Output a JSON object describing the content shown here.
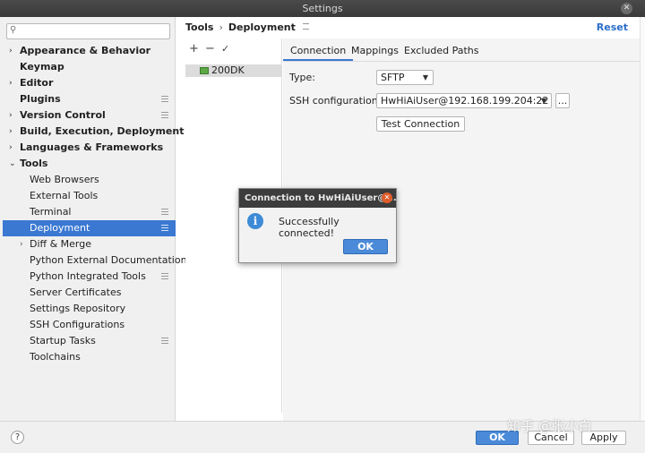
{
  "window": {
    "title": "Settings"
  },
  "search": {
    "placeholder": ""
  },
  "tree": [
    {
      "label": "Appearance & Behavior",
      "bold": true,
      "arrow": "›"
    },
    {
      "label": "Keymap",
      "bold": true
    },
    {
      "label": "Editor",
      "bold": true,
      "arrow": "›"
    },
    {
      "label": "Plugins",
      "bold": true,
      "page": true
    },
    {
      "label": "Version Control",
      "bold": true,
      "arrow": "›",
      "page": true
    },
    {
      "label": "Build, Execution, Deployment",
      "bold": true,
      "arrow": "›"
    },
    {
      "label": "Languages & Frameworks",
      "bold": true,
      "arrow": "›"
    },
    {
      "label": "Tools",
      "bold": true,
      "arrow": "⌄"
    },
    {
      "label": "Web Browsers"
    },
    {
      "label": "External Tools"
    },
    {
      "label": "Terminal",
      "page": true
    },
    {
      "label": "Deployment",
      "page": true,
      "selected": true
    },
    {
      "label": "Diff & Merge",
      "arrow": "›"
    },
    {
      "label": "Python External Documentation"
    },
    {
      "label": "Python Integrated Tools",
      "page": true
    },
    {
      "label": "Server Certificates"
    },
    {
      "label": "Settings Repository"
    },
    {
      "label": "SSH Configurations"
    },
    {
      "label": "Startup Tasks",
      "page": true
    },
    {
      "label": "Toolchains"
    }
  ],
  "header": {
    "crumb_parent": "Tools",
    "crumb_current": "Deployment",
    "reset": "Reset"
  },
  "servers": {
    "add": "+",
    "remove": "−",
    "check": "✓",
    "items": [
      "200DK"
    ]
  },
  "tabs": [
    "Connection",
    "Mappings",
    "Excluded Paths"
  ],
  "connection": {
    "type_label": "Type:",
    "type_value": "SFTP",
    "ssh_label": "SSH configuration:",
    "ssh_value": "HwHiAiUser@192.168.199.204:22",
    "browse": "...",
    "test_button": "Test Connection"
  },
  "dialog": {
    "title": "Connection to HwHiAiUser@...",
    "icon": "i",
    "message": "Successfully connected!",
    "ok": "OK"
  },
  "footer": {
    "help": "?",
    "ok": "OK",
    "cancel": "Cancel",
    "apply": "Apply"
  },
  "watermark": "知乎 @张小白",
  "colors": {
    "accent": "#3a78d2",
    "link": "#2a6ec9",
    "titlebar": "#3a3a3a"
  }
}
